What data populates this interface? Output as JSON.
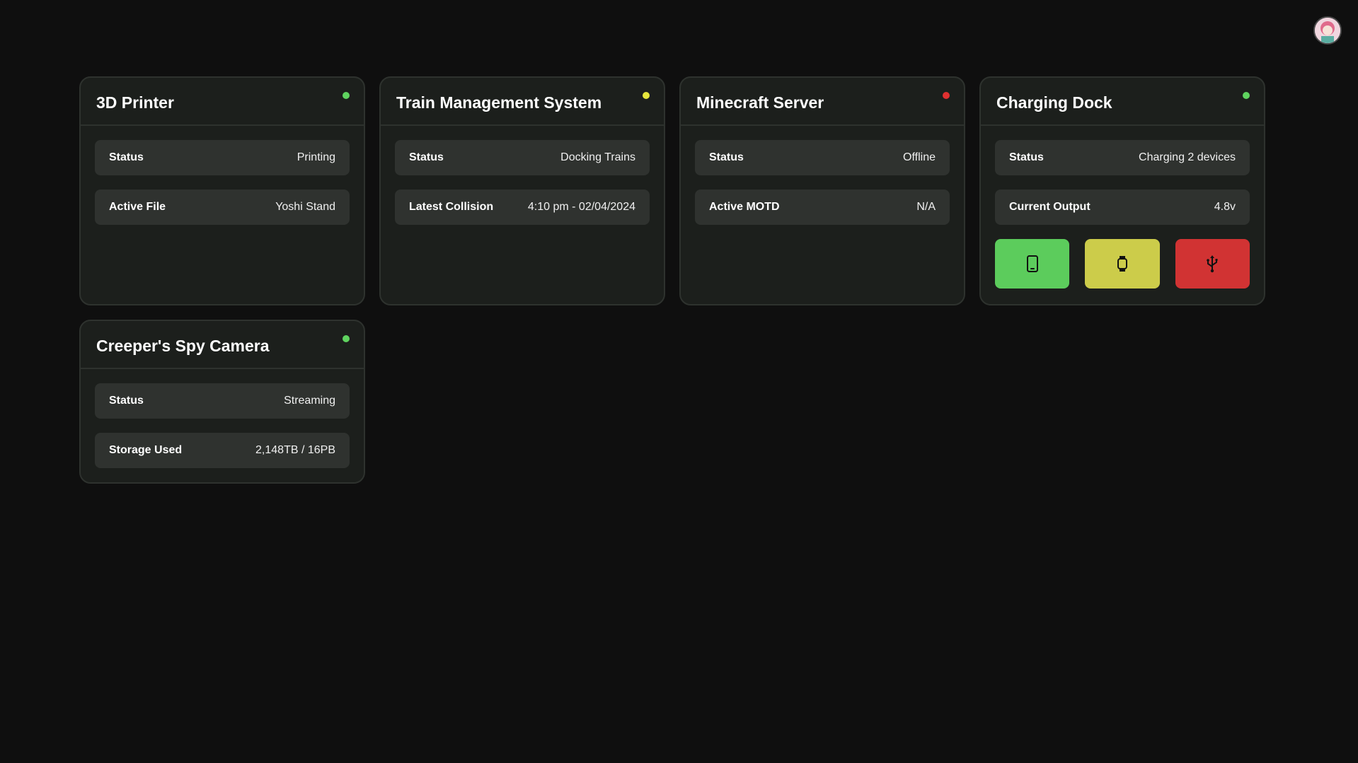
{
  "colors": {
    "online": "#5fd35f",
    "warning": "#e6e63c",
    "offline": "#e03030",
    "btn_phone": "#5ccc5c",
    "btn_watch": "#cccc4a",
    "btn_usb": "#d13333"
  },
  "cards": [
    {
      "title": "3D Printer",
      "status_dot": "online",
      "rows": [
        {
          "label": "Status",
          "value": "Printing"
        },
        {
          "label": "Active File",
          "value": "Yoshi Stand"
        }
      ]
    },
    {
      "title": "Train Management System",
      "status_dot": "warning",
      "rows": [
        {
          "label": "Status",
          "value": "Docking Trains"
        },
        {
          "label": "Latest Collision",
          "value": "4:10 pm - 02/04/2024"
        }
      ]
    },
    {
      "title": "Minecraft Server",
      "status_dot": "offline",
      "rows": [
        {
          "label": "Status",
          "value": "Offline"
        },
        {
          "label": "Active MOTD",
          "value": "N/A"
        }
      ]
    },
    {
      "title": "Charging Dock",
      "status_dot": "online",
      "rows": [
        {
          "label": "Status",
          "value": "Charging 2 devices"
        },
        {
          "label": "Current Output",
          "value": "4.8v"
        }
      ],
      "buttons": [
        {
          "icon": "phone-icon",
          "color": "#5ccc5c"
        },
        {
          "icon": "watch-icon",
          "color": "#cccc4a"
        },
        {
          "icon": "usb-icon",
          "color": "#d13333"
        }
      ]
    },
    {
      "title": "Creeper's Spy Camera",
      "status_dot": "online",
      "rows": [
        {
          "label": "Status",
          "value": "Streaming"
        },
        {
          "label": "Storage Used",
          "value": "2,148TB / 16PB"
        }
      ]
    }
  ]
}
